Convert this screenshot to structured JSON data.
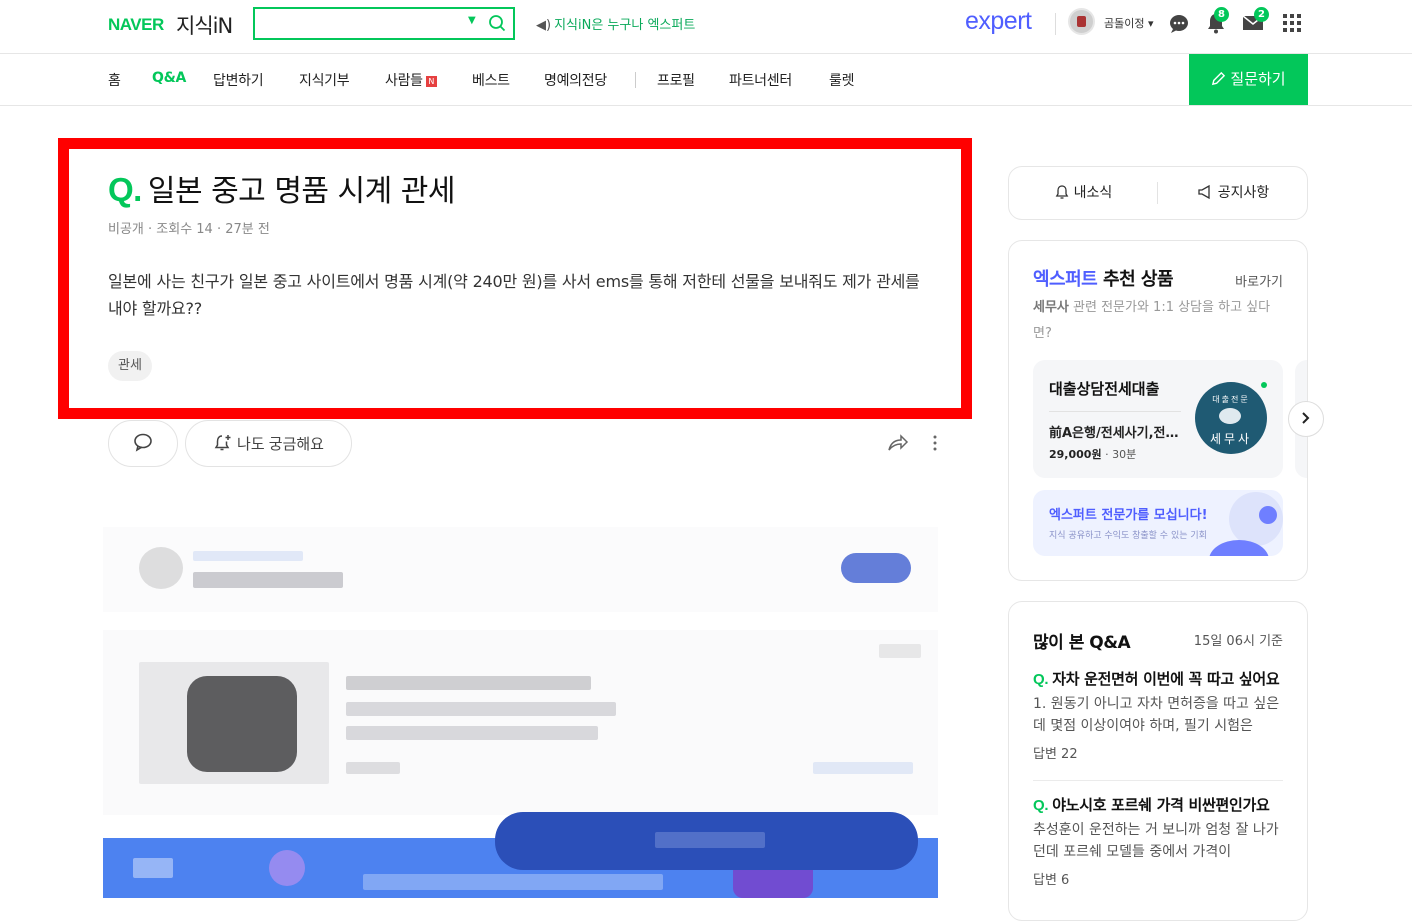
{
  "header": {
    "brand": "NAVER",
    "service": "지식iN",
    "search_placeholder": "",
    "promo": "지식iN은 누구나 엑스퍼트",
    "expert_logo": "expert",
    "username": "곰돌이정",
    "badges": {
      "notifications": "8",
      "mail": "2"
    }
  },
  "nav": {
    "items": [
      "홈",
      "Q&A",
      "답변하기",
      "지식기부",
      "사람들",
      "베스트",
      "명예의전당",
      "프로필",
      "파트너센터",
      "룰렛"
    ],
    "active": "Q&A",
    "new_badge": "N",
    "ask_button": "질문하기"
  },
  "question": {
    "q_mark": "Q.",
    "title": "일본 중고 명품 시계 관세",
    "meta": "비공개 · 조회수 14 · 27분 전",
    "body": "일본에 사는 친구가 일본 중고 사이트에서 명품 시계(약 240만 원)를 사서 ems를 통해 저한테 선물을 보내줘도 제가 관세를 내야 할까요??",
    "tag": "관세"
  },
  "actions": {
    "curious": "나도 궁금해요"
  },
  "sidebar": {
    "news": "내소식",
    "notice": "공지사항",
    "recommend": {
      "title_blue": "엑스퍼트",
      "title_rest": " 추천 상품",
      "link": "바로가기",
      "subtitle_bold": "세무사",
      "subtitle_rest": " 관련 전문가와 1:1 상담을 하고 싶다면?",
      "product": {
        "name": "대출상담전세대출",
        "desc": "前A은행/전세사기,전세대출",
        "price": "29,000원",
        "duration": "30분",
        "badge_top": "대출전문",
        "badge_bottom": "세무사"
      },
      "recruit_title": "엑스퍼트 전문가를 모십니다!",
      "recruit_sub": "지식 공유하고 수익도 창출할 수 있는 기회"
    },
    "popular": {
      "title": "많이 본 Q&A",
      "date": "15일 06시 기준",
      "items": [
        {
          "title": "자차 운전면허 이번에 꼭 따고 싶어요",
          "body": "1. 원동기 아니고 자차 면허증을 따고 싶은데 몇점 이상이여야 하며, 필기 시험은",
          "count": "답변 22"
        },
        {
          "title": "야노시호 포르쉐 가격 비싼편인가요",
          "body": "추성훈이 운전하는 거 보니까 엄청 잘 나가던데 포르쉐 모델들 중에서 가격이",
          "count": "답변 6"
        }
      ]
    }
  }
}
